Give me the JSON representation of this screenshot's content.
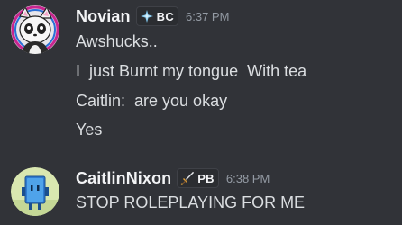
{
  "messages": [
    {
      "username": "Novian",
      "tag": {
        "text": "BC",
        "icon": "sparkle-icon"
      },
      "timestamp": "6:37 PM",
      "lines": [
        "Awshucks..",
        "I  just Burnt my tongue  With tea",
        "Caitlin:  are you okay",
        "Yes"
      ],
      "avatar_icon": "panda-cat-avatar"
    },
    {
      "username": "CaitlinNixon",
      "tag": {
        "text": "PB",
        "icon": "sword-icon"
      },
      "timestamp": "6:38 PM",
      "lines": [
        "STOP ROLEPLAYING FOR ME"
      ],
      "avatar_icon": "blue-robot-avatar"
    }
  ],
  "colors": {
    "background": "#313338",
    "username": "#f2f3f5",
    "text": "#dbdee1",
    "timestamp": "#949ba4"
  }
}
